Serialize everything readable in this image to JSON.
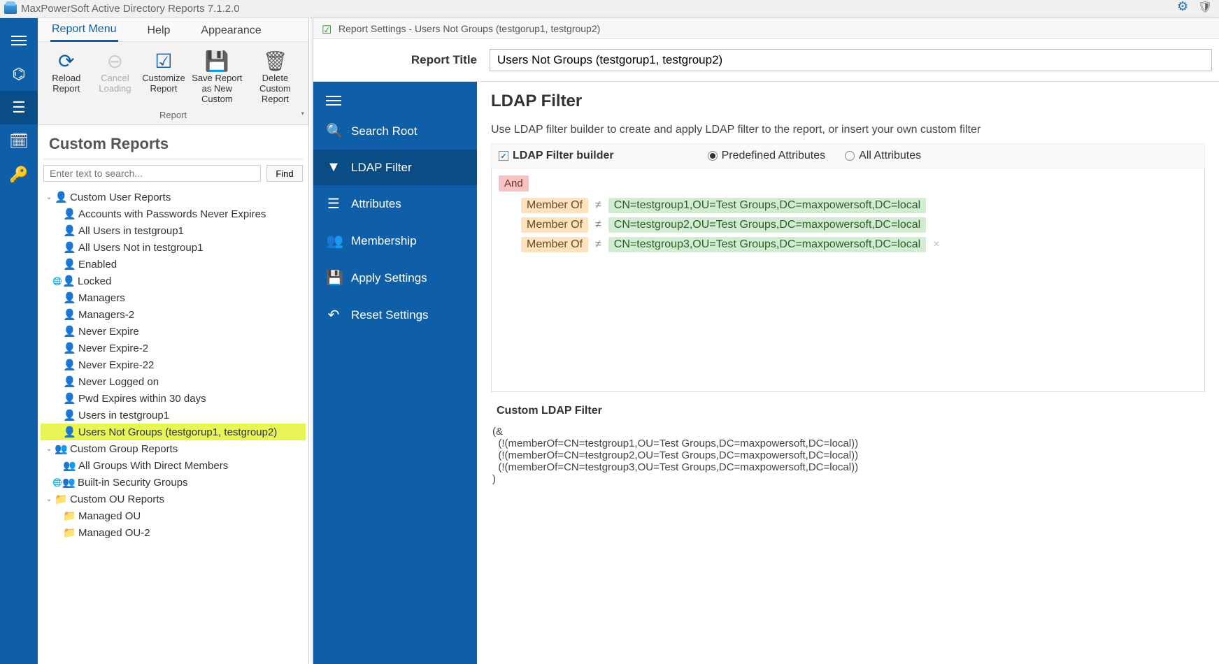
{
  "titlebar": {
    "app_title": "MaxPowerSoft Active Directory Reports 7.1.2.0"
  },
  "menu_tabs": {
    "report_menu": "Report Menu",
    "help": "Help",
    "appearance": "Appearance"
  },
  "ribbon": {
    "reload": "Reload\nReport",
    "cancel": "Cancel\nLoading",
    "customize": "Customize\nReport",
    "save_as": "Save Report\nas New Custom",
    "delete": "Delete Custom\nReport",
    "group_label": "Report"
  },
  "left_panel": {
    "header": "Custom Reports",
    "search_placeholder": "Enter text to search...",
    "find_label": "Find"
  },
  "tree": {
    "g_user": "Custom User Reports",
    "u1": "Accounts with Passwords Never Expires",
    "u2": "All Users in testgroup1",
    "u3": "All Users Not in testgroup1",
    "u4": "Enabled",
    "u5": "Locked",
    "u6": "Managers",
    "u7": "Managers-2",
    "u8": "Never Expire",
    "u9": "Never Expire-2",
    "u10": "Never Expire-22",
    "u11": "Never Logged on",
    "u12": "Pwd Expires within 30 days",
    "u13": "Users in testgroup1",
    "u14": "Users Not Groups (testgorup1, testgroup2)",
    "g_group": "Custom Group Reports",
    "g1": "All Groups With Direct Members",
    "g2": "Built-in Security Groups",
    "g_ou": "Custom OU Reports",
    "o1": "Managed OU",
    "o2": "Managed OU-2"
  },
  "settings": {
    "window_title": "Report Settings - Users Not Groups (testgorup1, testgroup2)",
    "report_title_label": "Report Title",
    "report_title_value": "Users Not Groups (testgorup1, testgroup2)"
  },
  "settings_nav": {
    "search_root": "Search Root",
    "ldap_filter": "LDAP Filter",
    "attributes": "Attributes",
    "membership": "Membership",
    "apply": "Apply Settings",
    "reset": "Reset Settings"
  },
  "filter": {
    "heading": "LDAP Filter",
    "description": "Use LDAP filter builder to create and apply LDAP filter to the report, or insert your own custom filter",
    "builder_label": "LDAP Filter builder",
    "radio_predef": "Predefined Attributes",
    "radio_all": "All Attributes",
    "and_label": "And",
    "cond_attr": "Member Of",
    "cond_op": "≠",
    "cond1_val": "CN=testgroup1,OU=Test Groups,DC=maxpowersoft,DC=local",
    "cond2_val": "CN=testgroup2,OU=Test Groups,DC=maxpowersoft,DC=local",
    "cond3_val": "CN=testgroup3,OU=Test Groups,DC=maxpowersoft,DC=local",
    "custom_label": "Custom LDAP Filter",
    "custom_text": "(&\n  (!(memberOf=CN=testgroup1,OU=Test Groups,DC=maxpowersoft,DC=local))\n  (!(memberOf=CN=testgroup2,OU=Test Groups,DC=maxpowersoft,DC=local))\n  (!(memberOf=CN=testgroup3,OU=Test Groups,DC=maxpowersoft,DC=local))\n)"
  }
}
